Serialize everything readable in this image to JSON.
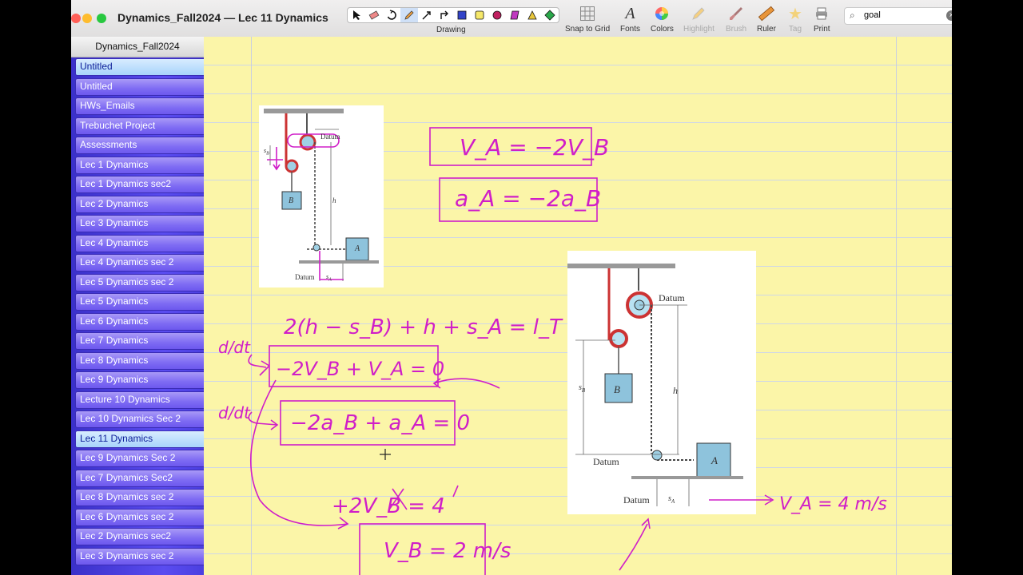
{
  "window": {
    "title": "Dynamics_Fall2024 — Lec 11 Dynamics"
  },
  "toolbar": {
    "drawing_label": "Drawing",
    "buttons": [
      {
        "label": "Snap to Grid",
        "icon": "grid-icon"
      },
      {
        "label": "Fonts",
        "icon": "fonts-icon"
      },
      {
        "label": "Colors",
        "icon": "color-wheel-icon"
      },
      {
        "label": "Highlight",
        "icon": "highlighter-icon"
      },
      {
        "label": "Brush",
        "icon": "brush-icon"
      },
      {
        "label": "Ruler",
        "icon": "ruler-icon"
      },
      {
        "label": "Tag",
        "icon": "star-icon"
      },
      {
        "label": "Print",
        "icon": "printer-icon"
      }
    ]
  },
  "search": {
    "value": "goal"
  },
  "sidebar": {
    "header": "Dynamics_Fall2024",
    "top_item": "Untitled",
    "items": [
      "Untitled",
      "HWs_Emails",
      "Trebuchet Project",
      "Assessments",
      "Lec 1 Dynamics",
      "Lec 1 Dynamics sec2",
      "Lec 2 Dynamics",
      "Lec 3 Dynamics",
      "Lec 4 Dynamics",
      "Lec 4 Dynamics sec 2",
      "Lec 5 Dynamics sec 2",
      "Lec 5 Dynamics",
      "Lec 6 Dynamics",
      "Lec 7 Dynamics",
      "Lec 8 Dynamics",
      "Lec 9 Dynamics",
      "Lecture 10 Dynamics",
      "Lec 10 Dynamics Sec 2",
      "Lec 11 Dynamics",
      "Lec 9 Dynamics Sec 2",
      "Lec 7 Dynamics Sec2",
      "Lec 8 Dynamics sec 2",
      "Lec 6 Dynamics sec 2",
      "Lec 2 Dynamics sec2",
      "Lec 3 Dynamics sec 2"
    ],
    "selected": "Lec 11 Dynamics"
  },
  "figure_small": {
    "datum_top": "Datum",
    "datum_bottom": "Datum",
    "label_b": "B",
    "label_a": "A",
    "label_h": "h",
    "label_sb": "s",
    "label_sb_sub": "B",
    "label_sa": "s",
    "label_sa_sub": "A"
  },
  "figure_large": {
    "datum_top": "Datum",
    "datum_mid": "Datum",
    "datum_bottom": "Datum",
    "label_b": "B",
    "label_a": "A",
    "label_h": "h",
    "label_sb": "s",
    "label_sb_sub": "B",
    "label_sa": "s",
    "label_sa_sub": "A"
  },
  "notes": {
    "eq_va": "V_A = −2V_B",
    "eq_aa": "a_A = −2a_B",
    "eq_length": "2(h − s_B) + h + s_A = l_T",
    "ddt1": "d/dt",
    "eq_vel": "−2V_B + V_A = 0",
    "ddt2": "d/dt",
    "eq_acc": "−2a_B + a_A = 0",
    "eq_sub": "+2V_B = 4",
    "eq_vb": "V_B = 2 m/s",
    "eq_va_given": "V_A = 4 m/s"
  },
  "colors": {
    "ink": "#d01ec8",
    "paper": "#fbf5a8",
    "sidebar": "#4b3fe0",
    "block": "#8ec3dc"
  }
}
